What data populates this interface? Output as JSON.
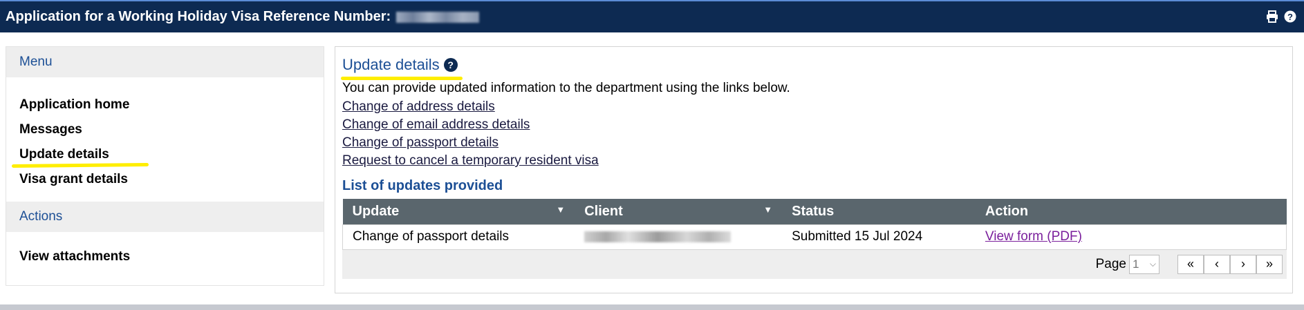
{
  "header": {
    "title": "Application for a Working Holiday Visa Reference Number:",
    "print_icon": "print-icon",
    "help_icon": "help-icon"
  },
  "sidebar": {
    "menu_heading": "Menu",
    "items": [
      {
        "label": "Application home"
      },
      {
        "label": "Messages"
      },
      {
        "label": "Update details"
      },
      {
        "label": "Visa grant details"
      }
    ],
    "actions_heading": "Actions",
    "actions": [
      {
        "label": "View attachments"
      }
    ]
  },
  "main": {
    "title": "Update details",
    "help_glyph": "?",
    "intro": "You can provide updated information to the department using the links below.",
    "links": [
      {
        "label": "Change of address details"
      },
      {
        "label": "Change of email address details"
      },
      {
        "label": "Change of passport details"
      },
      {
        "label": "Request to cancel a temporary resident visa"
      }
    ],
    "list_title": "List of updates provided",
    "table": {
      "columns": [
        "Update",
        "Client",
        "Status",
        "Action"
      ],
      "rows": [
        {
          "update": "Change of passport details",
          "status": "Submitted 15 Jul 2024",
          "action": "View form (PDF)"
        }
      ]
    },
    "pager": {
      "label": "Page",
      "selected": "1",
      "buttons": [
        "«",
        "‹",
        "›",
        "»"
      ]
    }
  },
  "colors": {
    "header_bg": "#0d2a52",
    "heading_blue": "#1c4f95",
    "table_header": "#5a666d",
    "highlight": "#ffee00",
    "visited_link": "#7a1f9c"
  }
}
